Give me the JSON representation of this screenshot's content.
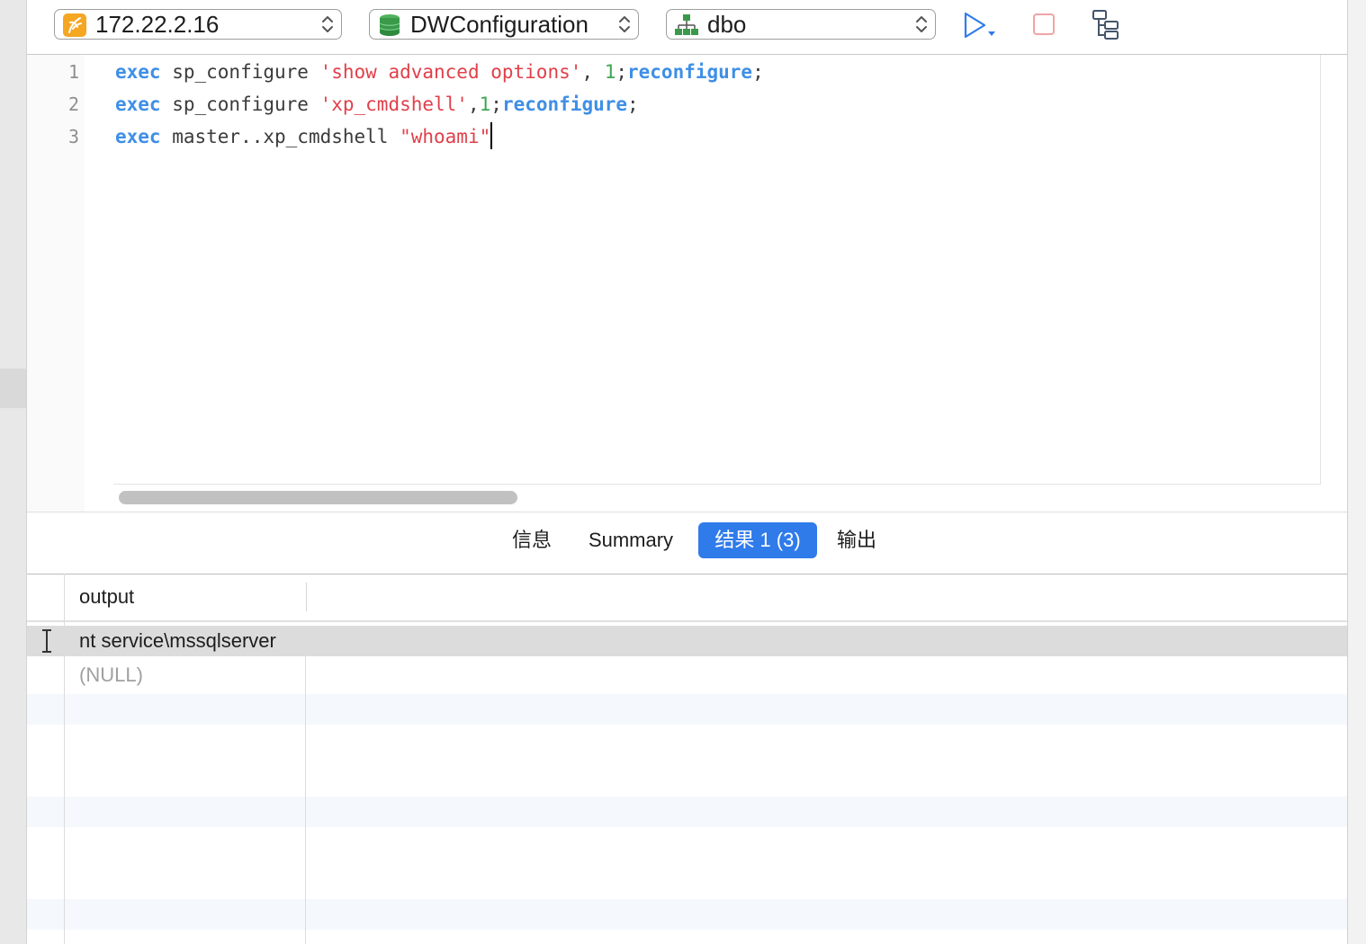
{
  "toolbar": {
    "connection": {
      "label": "172.22.2.16",
      "icon": "server-icon",
      "icon_color": "#f5a623"
    },
    "database": {
      "label": "DWConfiguration",
      "icon": "database-icon",
      "icon_color": "#3a9a4a"
    },
    "schema": {
      "label": "dbo",
      "icon": "schema-icon",
      "icon_color": "#3a9a4a"
    },
    "run_icon": "play-icon",
    "stop_icon": "stop-icon",
    "explain_icon": "explain-plan-icon",
    "accent_color": "#2f7bea"
  },
  "editor": {
    "line_numbers": [
      "1",
      "2",
      "3"
    ],
    "lines": [
      [
        {
          "t": "exec",
          "k": "kw"
        },
        {
          "t": " sp_configure ",
          "k": "plain"
        },
        {
          "t": "'show advanced options'",
          "k": "str"
        },
        {
          "t": ", ",
          "k": "plain"
        },
        {
          "t": "1",
          "k": "num"
        },
        {
          "t": ";",
          "k": "plain"
        },
        {
          "t": "reconfigure",
          "k": "kw"
        },
        {
          "t": ";",
          "k": "plain"
        }
      ],
      [
        {
          "t": "exec",
          "k": "kw"
        },
        {
          "t": " sp_configure ",
          "k": "plain"
        },
        {
          "t": "'xp_cmdshell'",
          "k": "str"
        },
        {
          "t": ",",
          "k": "plain"
        },
        {
          "t": "1",
          "k": "num"
        },
        {
          "t": ";",
          "k": "plain"
        },
        {
          "t": "reconfigure",
          "k": "kw"
        },
        {
          "t": ";",
          "k": "plain"
        }
      ],
      [
        {
          "t": "exec",
          "k": "kw"
        },
        {
          "t": " master..xp_cmdshell ",
          "k": "plain"
        },
        {
          "t": "\"whoami\"",
          "k": "str"
        }
      ]
    ]
  },
  "results_tabs": [
    {
      "label": "信息",
      "active": false
    },
    {
      "label": "Summary",
      "active": false
    },
    {
      "label": "结果 1 (3)",
      "active": true
    },
    {
      "label": "输出",
      "active": false
    }
  ],
  "grid": {
    "columns": [
      "output"
    ],
    "rows": [
      {
        "value": "nt service\\mssqlserver",
        "null": false,
        "selected": true
      },
      {
        "value": "(NULL)",
        "null": true,
        "selected": false
      }
    ]
  }
}
